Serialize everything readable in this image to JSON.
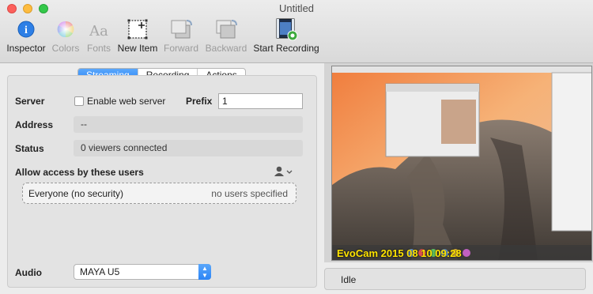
{
  "window": {
    "title": "Untitled"
  },
  "toolbar": {
    "items": [
      {
        "label": "Inspector",
        "icon": "info-icon",
        "enabled": true
      },
      {
        "label": "Colors",
        "icon": "color-wheel-icon",
        "enabled": false
      },
      {
        "label": "Fonts",
        "icon": "fonts-icon",
        "enabled": false
      },
      {
        "label": "New Item",
        "icon": "new-item-icon",
        "enabled": true
      },
      {
        "label": "Forward",
        "icon": "bring-forward-icon",
        "enabled": false
      },
      {
        "label": "Backward",
        "icon": "send-backward-icon",
        "enabled": false
      },
      {
        "label": "Start Recording",
        "icon": "start-recording-icon",
        "enabled": true
      }
    ]
  },
  "tabs": [
    {
      "label": "Streaming",
      "active": true
    },
    {
      "label": "Recording",
      "active": false
    },
    {
      "label": "Actions",
      "active": false
    }
  ],
  "server": {
    "label": "Server",
    "checkbox_label": "Enable web server",
    "checked": false,
    "prefix_label": "Prefix",
    "prefix_value": "1"
  },
  "address": {
    "label": "Address",
    "value": "--"
  },
  "status": {
    "label": "Status",
    "value": "0 viewers connected"
  },
  "access": {
    "heading": "Allow access by these users",
    "user_name": "Everyone (no security)",
    "user_note": "no users specified",
    "icon": "user-menu-icon"
  },
  "audio": {
    "label": "Audio",
    "value": "MAYA U5"
  },
  "preview": {
    "status_text": "Idle",
    "overlay_text": "EvoCam  2015 08 10 09:28",
    "colors": {
      "sky_top": "#f4a24e",
      "sky_mid": "#f6c28c",
      "rock": "#5b5048"
    }
  },
  "colors": {
    "accent": "#2c85f6"
  }
}
